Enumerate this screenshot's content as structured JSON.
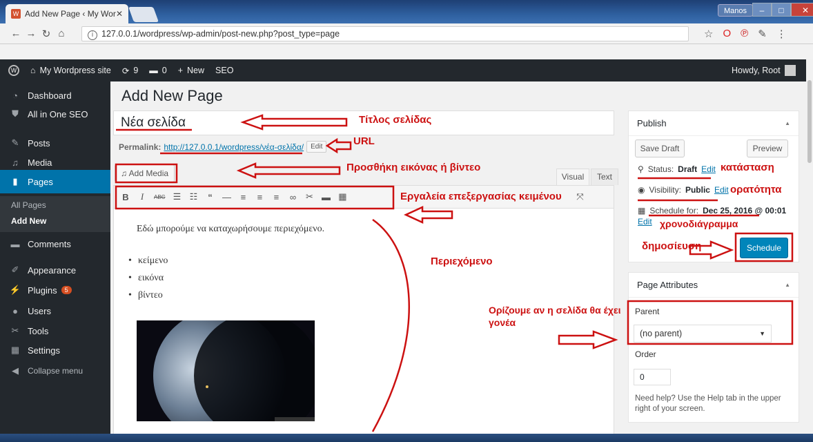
{
  "browser": {
    "tab_title": "Add New Page ‹ My Wor",
    "url": "127.0.0.1/wordpress/wp-admin/post-new.php?post_type=page",
    "window_user": "Manos"
  },
  "adminbar": {
    "site_name": "My Wordpress site",
    "updates": "9",
    "comments": "0",
    "new_label": "New",
    "seo_label": "SEO",
    "howdy": "Howdy, Root"
  },
  "sidebar": {
    "items": [
      {
        "label": "Dashboard",
        "icon": "dashboard-icon"
      },
      {
        "label": "All in One SEO",
        "icon": "seo-icon"
      },
      {
        "label": "Posts",
        "icon": "pin-icon"
      },
      {
        "label": "Media",
        "icon": "media-icon"
      },
      {
        "label": "Pages",
        "icon": "pages-icon"
      },
      {
        "label": "Comments",
        "icon": "comment-icon"
      },
      {
        "label": "Appearance",
        "icon": "brush-icon"
      },
      {
        "label": "Plugins",
        "icon": "plugin-icon",
        "badge": "5"
      },
      {
        "label": "Users",
        "icon": "users-icon"
      },
      {
        "label": "Tools",
        "icon": "wrench-icon"
      },
      {
        "label": "Settings",
        "icon": "settings-icon"
      },
      {
        "label": "Collapse menu",
        "icon": "collapse-icon"
      }
    ],
    "sub_items": [
      "All Pages",
      "Add New"
    ]
  },
  "main": {
    "page_title": "Add New Page",
    "title_value": "Νέα σελίδα",
    "permalink_label": "Permalink:",
    "permalink_url": "http://127.0.0.1/wordpress/νέα-σελίδα/",
    "permalink_edit": "Edit",
    "add_media": "Add Media",
    "tab_visual": "Visual",
    "tab_text": "Text",
    "content_paragraph": "Εδώ μπορούμε να καταχωρήσουμε περιεχόμενο.",
    "content_list": [
      "κείμενο",
      "εικόνα",
      "βίντεο"
    ]
  },
  "publish": {
    "header": "Publish",
    "save_draft": "Save Draft",
    "preview": "Preview",
    "status_label": "Status:",
    "status_value": "Draft",
    "visibility_label": "Visibility:",
    "visibility_value": "Public",
    "schedule_label": "Schedule for:",
    "schedule_value": "Dec 25, 2016 @ 00:01",
    "edit": "Edit",
    "schedule_button": "Schedule"
  },
  "attributes": {
    "header": "Page Attributes",
    "parent_label": "Parent",
    "parent_value": "(no parent)",
    "order_label": "Order",
    "order_value": "0",
    "help": "Need help? Use the Help tab in the upper right of your screen."
  },
  "annotations": {
    "title": "Τίτλος σελίδας",
    "url": "URL",
    "media": "Προσθήκη εικόνας ή βίντεο",
    "tools": "Εργαλεία επεξεργασίας κειμένου",
    "content": "Περιεχόμενο",
    "status": "κατάσταση",
    "visibility": "ορατότητα",
    "schedule": "χρονοδιάγραμμα",
    "publish": "δημοσίευση",
    "parent": "Ορίζουμε αν η σελίδα θα έχει γονέα"
  },
  "colors": {
    "accent": "#0073aa",
    "adminbar": "#23282d",
    "annotation": "#cc1111",
    "schedule_button": "#0085ba"
  }
}
